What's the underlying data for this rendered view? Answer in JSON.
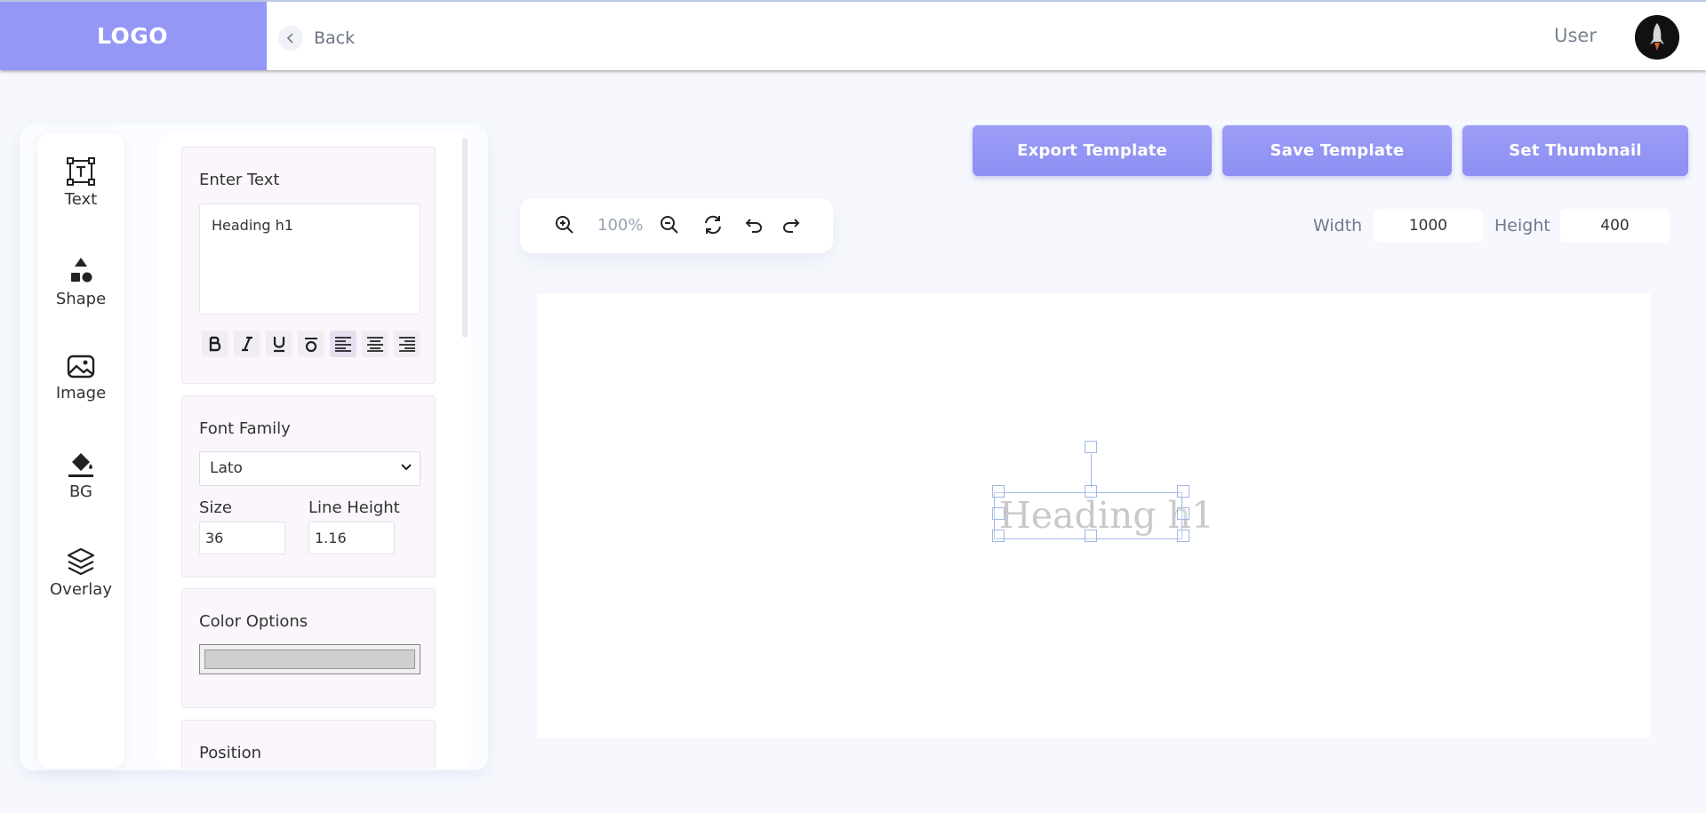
{
  "header": {
    "logo": "LOGO",
    "back_label": "Back",
    "user_label": "User"
  },
  "tools": [
    {
      "label": "Text",
      "icon": "text-tool-icon"
    },
    {
      "label": "Shape",
      "icon": "shape-tool-icon"
    },
    {
      "label": "Image",
      "icon": "image-tool-icon"
    },
    {
      "label": "BG",
      "icon": "paint-bucket-icon"
    },
    {
      "label": "Overlay",
      "icon": "layers-icon"
    }
  ],
  "editor": {
    "text_section": {
      "title": "Enter Text",
      "value": "Heading h1",
      "format_buttons": [
        "bold",
        "italic",
        "underline",
        "strikethrough",
        "align-left",
        "align-center",
        "align-right"
      ],
      "active_alignment": "align-left"
    },
    "font_section": {
      "title": "Font Family",
      "font_value": "Lato",
      "size_label": "Size",
      "size_value": "36",
      "line_height_label": "Line Height",
      "line_height_value": "1.16"
    },
    "color_section": {
      "title": "Color Options",
      "color": "#cfcfcf"
    },
    "position_section": {
      "title": "Position"
    }
  },
  "actions": {
    "export": "Export Template",
    "save": "Save Template",
    "thumbnail": "Set Thumbnail"
  },
  "zoom": {
    "level": "100%"
  },
  "dimensions": {
    "width_label": "Width",
    "width_value": "1000",
    "height_label": "Height",
    "height_value": "400"
  },
  "canvas": {
    "heading_text": "Heading h1"
  },
  "colors": {
    "accent": "#9497f5",
    "background": "#f6f8fd",
    "selection": "#9fb6e6"
  }
}
